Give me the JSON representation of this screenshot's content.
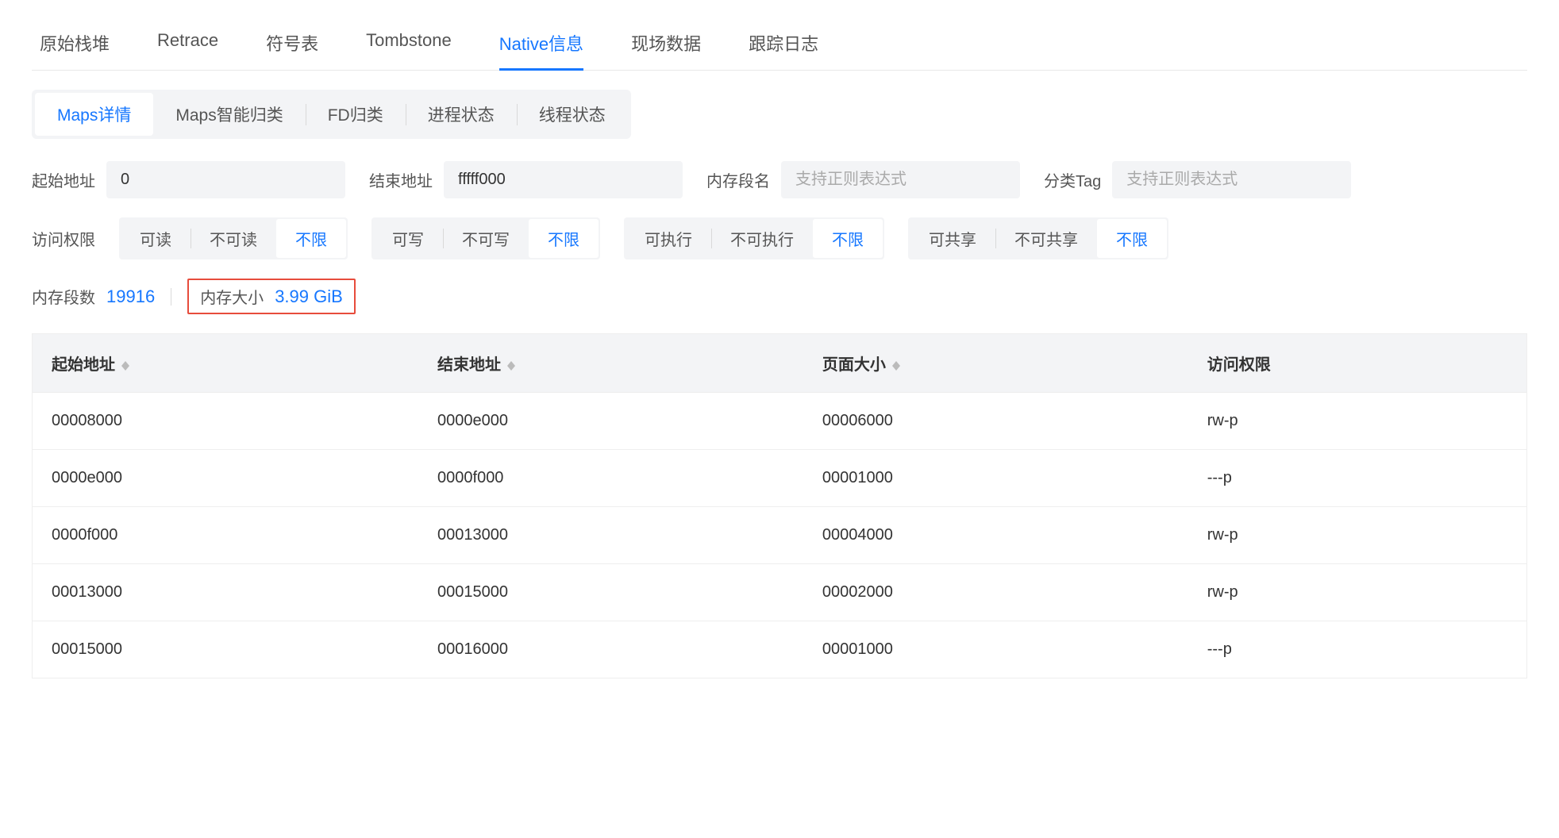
{
  "tabs": {
    "items": [
      {
        "label": "原始栈堆"
      },
      {
        "label": "Retrace"
      },
      {
        "label": "符号表"
      },
      {
        "label": "Tombstone"
      },
      {
        "label": "Native信息"
      },
      {
        "label": "现场数据"
      },
      {
        "label": "跟踪日志"
      }
    ],
    "active_index": 4
  },
  "sub_tabs": {
    "items": [
      {
        "label": "Maps详情"
      },
      {
        "label": "Maps智能归类"
      },
      {
        "label": "FD归类"
      },
      {
        "label": "进程状态"
      },
      {
        "label": "线程状态"
      }
    ],
    "active_index": 0
  },
  "filters": {
    "start_addr": {
      "label": "起始地址",
      "value": "0"
    },
    "end_addr": {
      "label": "结束地址",
      "value": "fffff000"
    },
    "seg_name": {
      "label": "内存段名",
      "placeholder": "支持正则表达式"
    },
    "tag": {
      "label": "分类Tag",
      "placeholder": "支持正则表达式"
    },
    "perm_label": "访问权限",
    "perm_groups": {
      "read": {
        "options": [
          "可读",
          "不可读",
          "不限"
        ],
        "active_index": 2
      },
      "write": {
        "options": [
          "可写",
          "不可写",
          "不限"
        ],
        "active_index": 2
      },
      "exec": {
        "options": [
          "可执行",
          "不可执行",
          "不限"
        ],
        "active_index": 2
      },
      "share": {
        "options": [
          "可共享",
          "不可共享",
          "不限"
        ],
        "active_index": 2
      }
    }
  },
  "stats": {
    "seg_count_label": "内存段数",
    "seg_count_value": "19916",
    "mem_size_label": "内存大小",
    "mem_size_value": "3.99 GiB"
  },
  "table": {
    "columns": [
      {
        "label": "起始地址",
        "sortable": true
      },
      {
        "label": "结束地址",
        "sortable": true
      },
      {
        "label": "页面大小",
        "sortable": true
      },
      {
        "label": "访问权限",
        "sortable": false
      }
    ],
    "rows": [
      {
        "start": "00008000",
        "end": "0000e000",
        "size": "00006000",
        "perm": "rw-p"
      },
      {
        "start": "0000e000",
        "end": "0000f000",
        "size": "00001000",
        "perm": "---p"
      },
      {
        "start": "0000f000",
        "end": "00013000",
        "size": "00004000",
        "perm": "rw-p"
      },
      {
        "start": "00013000",
        "end": "00015000",
        "size": "00002000",
        "perm": "rw-p"
      },
      {
        "start": "00015000",
        "end": "00016000",
        "size": "00001000",
        "perm": "---p"
      }
    ]
  }
}
